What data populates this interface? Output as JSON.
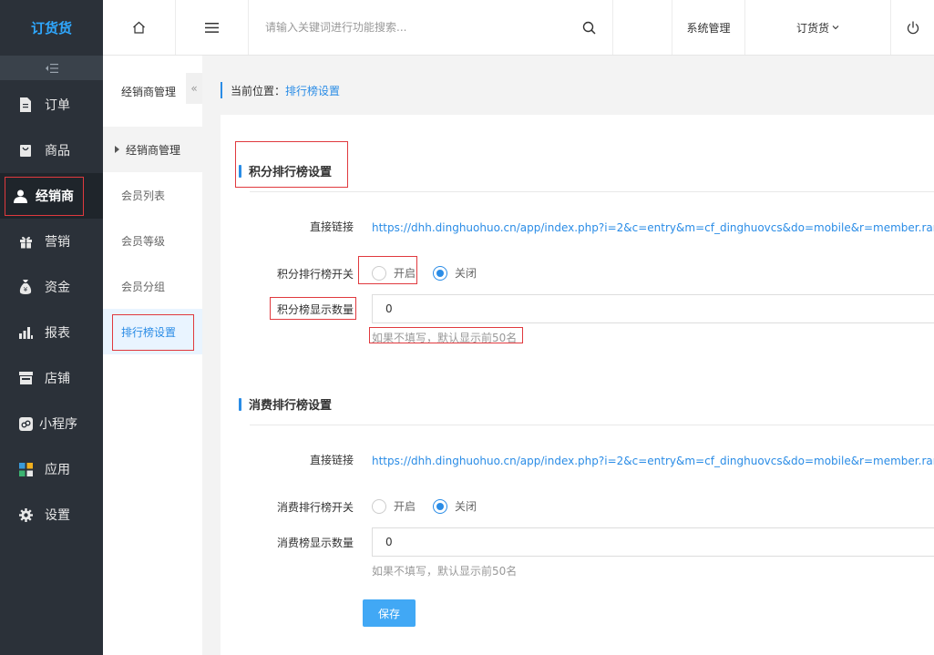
{
  "app": {
    "logo_text": "订货货",
    "brand_color": "#2fa8ff",
    "accent": "#2a8ce6",
    "highlight": "#e0393e"
  },
  "sidebar": {
    "items": [
      {
        "label": "订单",
        "icon": "document-icon"
      },
      {
        "label": "商品",
        "icon": "bag-icon"
      },
      {
        "label": "经销商",
        "icon": "user-icon",
        "active": true
      },
      {
        "label": "营销",
        "icon": "gift-icon"
      },
      {
        "label": "资金",
        "icon": "money-bag-icon"
      },
      {
        "label": "报表",
        "icon": "bar-chart-icon"
      },
      {
        "label": "店铺",
        "icon": "store-icon"
      },
      {
        "label": "小程序",
        "icon": "mini-program-icon"
      },
      {
        "label": "应用",
        "icon": "apps-grid-icon"
      },
      {
        "label": "设置",
        "icon": "gear-icon"
      }
    ]
  },
  "topbar": {
    "search_placeholder": "请输入关键词进行功能搜索...",
    "system_label": "系统管理",
    "user_label": "订货货"
  },
  "subnav": {
    "header": "经销商管理",
    "group": "经销商管理",
    "items": [
      "会员列表",
      "会员等级",
      "会员分组",
      "排行榜设置"
    ],
    "active_index": 3
  },
  "breadcrumb": {
    "prefix": "当前位置：",
    "current": "排行榜设置"
  },
  "points_section": {
    "title": "积分排行榜设置",
    "link_label": "直接链接",
    "link_url": "https://dhh.dinghuohuo.cn/app/index.php?i=2&c=entry&m=cf_dinghuovcs&do=mobile&r=member.rank",
    "switch_label": "积分排行榜开关",
    "on_label": "开启",
    "off_label": "关闭",
    "selected": "off",
    "count_label": "积分榜显示数量",
    "count_value": "0",
    "hint": "如果不填写，默认显示前50名"
  },
  "consume_section": {
    "title": "消费排行榜设置",
    "link_label": "直接链接",
    "link_url": "https://dhh.dinghuohuo.cn/app/index.php?i=2&c=entry&m=cf_dinghuovcs&do=mobile&r=member.rank.c",
    "switch_label": "消费排行榜开关",
    "on_label": "开启",
    "off_label": "关闭",
    "selected": "off",
    "count_label": "消费榜显示数量",
    "count_value": "0",
    "hint": "如果不填写，默认显示前50名"
  },
  "save_label": "保存"
}
